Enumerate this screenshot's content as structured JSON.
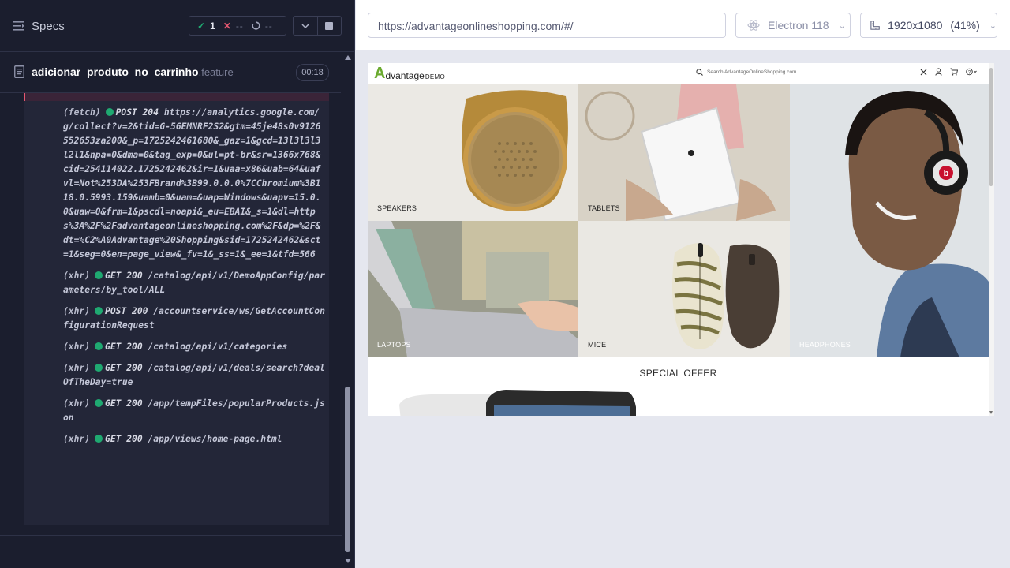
{
  "reporter": {
    "specs_label": "Specs",
    "stats": {
      "passed": "1",
      "failed": "--",
      "pending": "--"
    },
    "spec": {
      "name": "adicionar_produto_no_carrinho",
      "ext": ".feature",
      "duration": "00:18"
    },
    "logs": [
      {
        "kind": "(fetch)",
        "method": "POST 204",
        "url": "https://analytics.google.com/g/collect?v=2&tid=G-56EMNRF2S2&gtm=45je48s0v9126552653za200&_p=1725242461680&_gaz=1&gcd=13l3l3l3l2l1&npa=0&dma=0&tag_exp=0&ul=pt-br&sr=1366x768&cid=254114022.1725242462&ir=1&uaa=x86&uab=64&uafvl=Not%253DA%253FBrand%3B99.0.0.0%7CChromium%3B118.0.5993.159&uamb=0&uam=&uap=Windows&uapv=15.0.0&uaw=0&frm=1&pscdl=noapi&_eu=EBAI&_s=1&dl=https%3A%2F%2Fadvantageonlineshopping.com%2F&dp=%2F&dt=%C2%A0Advantage%20Shopping&sid=1725242462&sct=1&seg=0&en=page_view&_fv=1&_ss=1&_ee=1&tfd=566"
      },
      {
        "kind": "(xhr)",
        "method": "GET 200",
        "url": "/catalog/api/v1/DemoAppConfig/parameters/by_tool/ALL"
      },
      {
        "kind": "(xhr)",
        "method": "POST 200",
        "url": "/accountservice/ws/GetAccountConfigurationRequest"
      },
      {
        "kind": "(xhr)",
        "method": "GET 200",
        "url": "/catalog/api/v1/categories"
      },
      {
        "kind": "(xhr)",
        "method": "GET 200",
        "url": "/catalog/api/v1/deals/search?dealOfTheDay=true"
      },
      {
        "kind": "(xhr)",
        "method": "GET 200",
        "url": "/app/tempFiles/popularProducts.json"
      },
      {
        "kind": "(xhr)",
        "method": "GET 200",
        "url": "/app/views/home-page.html"
      }
    ]
  },
  "aut": {
    "url": "https://advantageonlineshopping.com/#/",
    "browser": "Electron 118",
    "viewport": "1920x1080",
    "zoom": "(41%)",
    "site": {
      "logo_a": "A",
      "logo_main": "dvantage",
      "logo_demo": "DEMO",
      "search_placeholder": "Search AdvantageOnlineShopping.com",
      "categories": {
        "speakers": "SPEAKERS",
        "tablets": "TABLETS",
        "headphones": "HEADPHONES",
        "laptops": "LAPTOPS",
        "mice": "MICE"
      },
      "special_offer": "SPECIAL OFFER"
    }
  },
  "colors": {
    "reporter_bg": "#1b1e2e",
    "pass": "#1fa971",
    "fail": "#e45770",
    "logo_green": "#6aaa2e"
  },
  "icons": [
    "list-icon",
    "check-icon",
    "x-icon",
    "spinner-icon",
    "chevron-down-icon",
    "stop-icon",
    "document-icon",
    "electron-icon",
    "ruler-icon",
    "search-icon",
    "close-icon",
    "user-icon",
    "cart-icon",
    "help-icon"
  ]
}
